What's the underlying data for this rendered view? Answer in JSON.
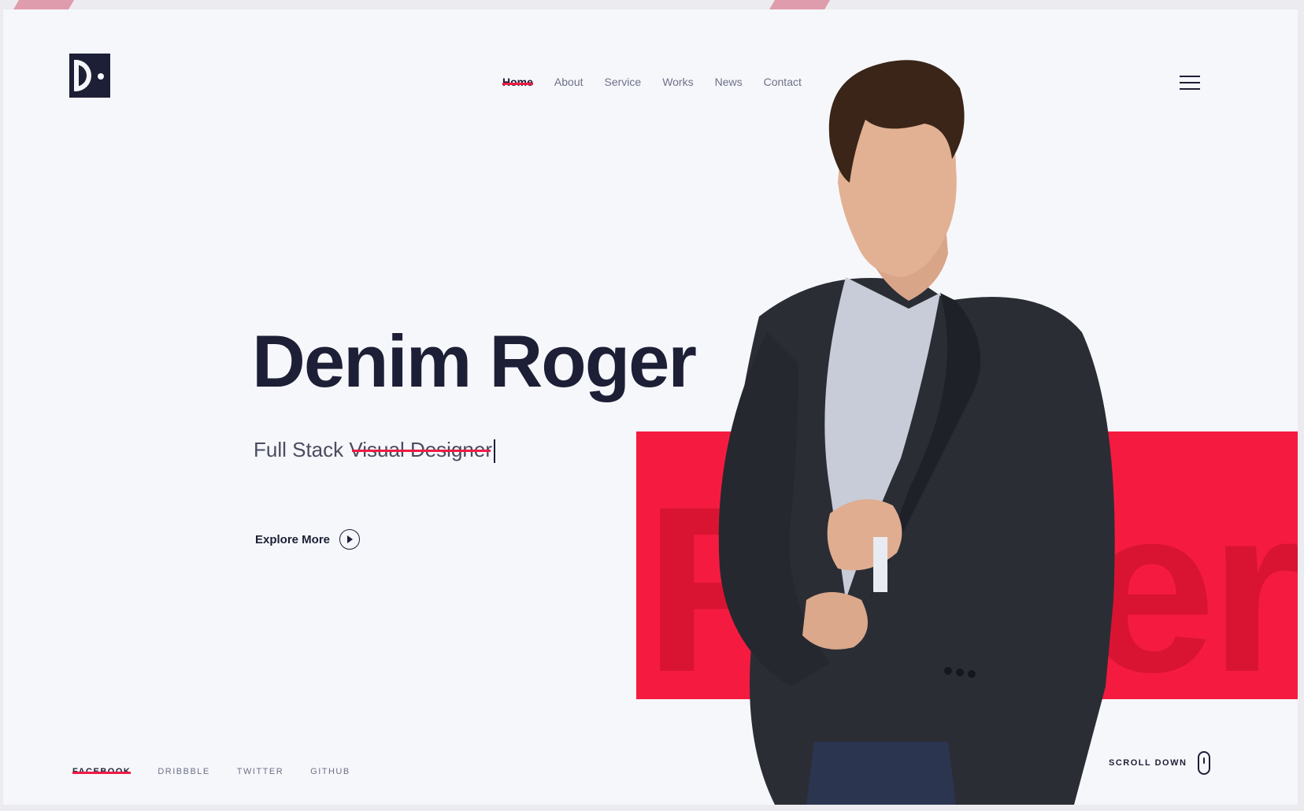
{
  "brand": {
    "logo_icon": "d-logo-icon",
    "accent_color": "#ef1b45",
    "dark_color": "#1d1f36"
  },
  "nav": {
    "items": [
      {
        "label": "Home",
        "active": true
      },
      {
        "label": "About"
      },
      {
        "label": "Service"
      },
      {
        "label": "Works"
      },
      {
        "label": "News"
      },
      {
        "label": "Contact"
      }
    ],
    "menu_icon": "hamburger-menu-icon"
  },
  "hero": {
    "name": "Denim Roger",
    "subtitle_prefix": "Full Stack ",
    "subtitle_typed": "Visual Designer",
    "explore_label": "Explore More",
    "explore_icon": "play-circle-icon",
    "background_word": "Roger"
  },
  "social": {
    "items": [
      {
        "label": "FACEBOOK",
        "active": true
      },
      {
        "label": "DRIBBBLE"
      },
      {
        "label": "TWITTER"
      },
      {
        "label": "GITHUB"
      }
    ]
  },
  "scroll": {
    "label": "SCROLL DOWN",
    "icon": "mouse-icon"
  }
}
